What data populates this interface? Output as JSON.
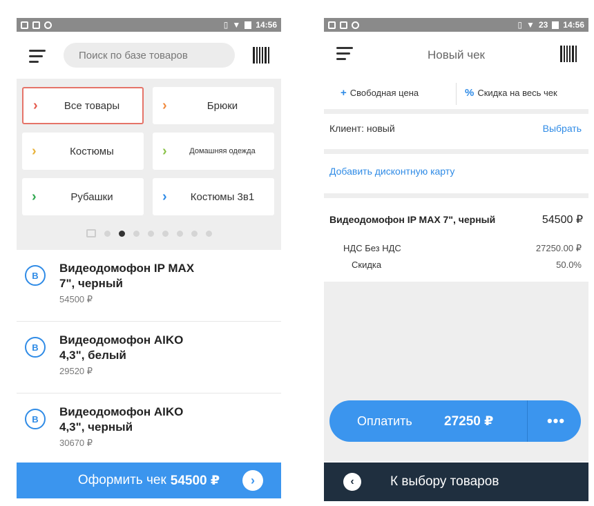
{
  "status_bar": {
    "time": "14:56",
    "battery": "23"
  },
  "left": {
    "search_placeholder": "Поиск по базе товаров",
    "categories": [
      {
        "label": "Все товары",
        "color": "#e5594c"
      },
      {
        "label": "Брюки",
        "color": "#f08a3e"
      },
      {
        "label": "Костюмы",
        "color": "#e8b23a"
      },
      {
        "label": "Домашняя одежда",
        "color": "#8bc34a"
      },
      {
        "label": "Рубашки",
        "color": "#2fa84f"
      },
      {
        "label": "Костюмы 3в1",
        "color": "#2f8be6"
      }
    ],
    "products": [
      {
        "badge": "B",
        "name": "Видеодомофон IP MAX 7\", черный",
        "price": "54500 ₽"
      },
      {
        "badge": "B",
        "name": "Видеодомофон AIKO 4,3\", белый",
        "price": "29520 ₽"
      },
      {
        "badge": "B",
        "name": "Видеодомофон AIKO 4,3\", черный",
        "price": "30670 ₽"
      }
    ],
    "checkout": {
      "label": "Оформить чек",
      "amount": "54500 ₽",
      "arrow": "›"
    }
  },
  "right": {
    "title": "Новый чек",
    "free_price": "Свободная цена",
    "discount_all": "Скидка на весь чек",
    "client_label": "Клиент: новый",
    "pick_label": "Выбрать",
    "add_card": "Добавить дисконтную карту",
    "item": {
      "name": "Видеодомофон IP MAX 7\", черный",
      "price": "54500 ₽",
      "vat_label": "НДС Без НДС",
      "vat_value": "27250.00 ₽",
      "discount_label": "Скидка",
      "discount_value": "50.0%"
    },
    "pay": {
      "label": "Оплатить",
      "amount": "27250 ₽",
      "more": "•••"
    },
    "back": {
      "arrow": "‹",
      "label": "К выбору товаров"
    }
  }
}
